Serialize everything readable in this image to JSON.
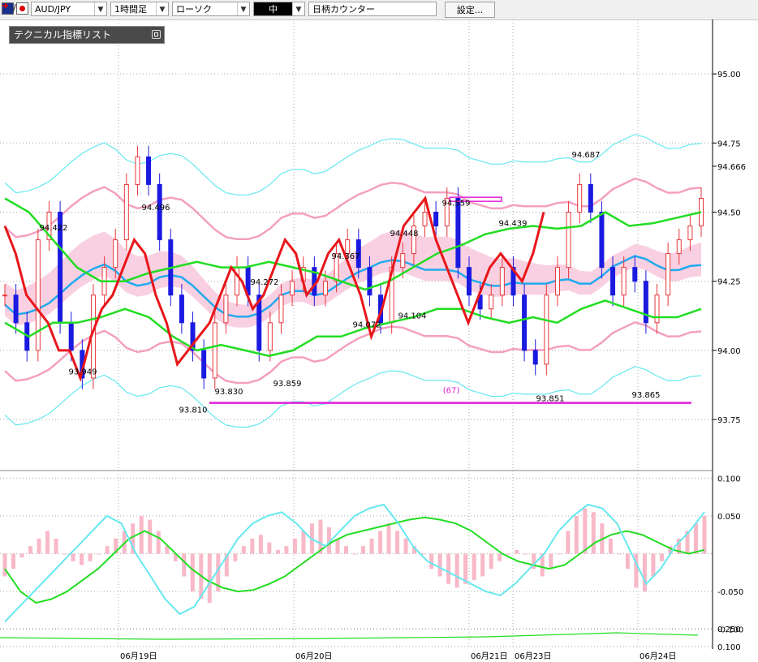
{
  "toolbar": {
    "symbol": "AUD/JPY",
    "symbol_sep": "/",
    "timeframe": "1時間足",
    "chart_type": "ローソク",
    "size": "中",
    "counter_label": "日柄カウンター",
    "settings_label": "設定...",
    "icons": {
      "australia_flag": "australia-flag-icon",
      "japan_flag": "japan-flag-icon",
      "dropdown": "chevron-down-icon"
    }
  },
  "indicator_panel": {
    "title": "テクニカル指標リスト",
    "button_icon": "restore-icon"
  },
  "colors": {
    "bull": "#e8373c",
    "bear": "#1a1ae0",
    "red_line": "#e8161a",
    "green": "#22dd22",
    "bb_outer": "#66e8f0",
    "bb_inner": "#f4a0c0",
    "ma": "#22aaee",
    "cloud": "#f8c8dc",
    "cloud_blue": "#c8e0f8",
    "magenta": "#e020d8",
    "macd_hist": "#f8b8c8",
    "grid": "#aaaaaa"
  },
  "chart_data": [
    {
      "type": "candlestick",
      "symbol": "AUD/JPY",
      "timeframe": "1時間足",
      "ylim": [
        93.58,
        95.15
      ],
      "y_ticks": [
        "95.00",
        "94.75",
        "94.666",
        "94.50",
        "94.25",
        "94.00",
        "93.75"
      ],
      "x_labels": [
        "06月19日",
        "06月20日",
        "06月21日",
        "06月23日",
        "06月24日"
      ],
      "annotations": [
        {
          "text": "94.422",
          "price": 94.422
        },
        {
          "text": "93.949",
          "price": 93.949
        },
        {
          "text": "94.496",
          "price": 94.496
        },
        {
          "text": "93.810",
          "price": 93.81
        },
        {
          "text": "93.830",
          "price": 93.83
        },
        {
          "text": "94.272",
          "price": 94.272
        },
        {
          "text": "93.859",
          "price": 93.859
        },
        {
          "text": "94.367",
          "price": 94.367
        },
        {
          "text": "94.072",
          "price": 94.072
        },
        {
          "text": "94.448",
          "price": 94.448
        },
        {
          "text": "94.104",
          "price": 94.104
        },
        {
          "text": "94.559",
          "price": 94.559
        },
        {
          "text": "94.439",
          "price": 94.439
        },
        {
          "text": "93.851",
          "price": 93.851
        },
        {
          "text": "94.687",
          "price": 94.687
        },
        {
          "text": "93.865",
          "price": 93.865
        },
        {
          "text": "(67)",
          "price": 93.86
        }
      ],
      "levels": [
        {
          "name": "low-line",
          "price": 93.81
        },
        {
          "name": "high-box",
          "price": 94.545
        }
      ],
      "series": [
        {
          "name": "close",
          "values": [
            94.2,
            94.1,
            94.0,
            94.4,
            94.5,
            94.1,
            94.0,
            93.9,
            94.2,
            94.3,
            94.4,
            94.6,
            94.7,
            94.6,
            94.4,
            94.2,
            94.1,
            94.0,
            93.9,
            94.1,
            94.2,
            94.3,
            94.2,
            94.0,
            94.1,
            94.2,
            94.25,
            94.3,
            94.2,
            94.25,
            94.35,
            94.4,
            94.3,
            94.2,
            94.1,
            94.3,
            94.35,
            94.45,
            94.5,
            94.45,
            94.55,
            94.3,
            94.2,
            94.15,
            94.2,
            94.3,
            94.2,
            94.0,
            93.95,
            94.2,
            94.3,
            94.5,
            94.6,
            94.5,
            94.3,
            94.2,
            94.3,
            94.25,
            94.1,
            94.2,
            94.35,
            94.4,
            94.45,
            94.55
          ]
        },
        {
          "name": "red-line",
          "values": [
            94.45,
            94.35,
            94.2,
            94.15,
            94.1,
            94.0,
            94.0,
            93.9,
            94.05,
            94.15,
            94.2,
            94.3,
            94.4,
            94.35,
            94.2,
            94.1,
            93.95,
            94.0,
            94.05,
            94.1,
            94.2,
            94.3,
            94.25,
            94.15,
            94.2,
            94.3,
            94.4,
            94.35,
            94.2,
            94.25,
            94.35,
            94.4,
            94.3,
            94.2,
            94.05,
            94.15,
            94.3,
            94.45,
            94.5,
            94.55,
            94.4,
            94.3,
            94.2,
            94.1,
            94.2,
            94.3,
            94.35,
            94.3,
            94.25,
            94.35,
            94.5
          ]
        },
        {
          "name": "green-upper",
          "values": [
            94.55,
            94.5,
            94.4,
            94.3,
            94.25,
            94.25,
            94.28,
            94.3,
            94.32,
            94.3,
            94.3,
            94.32,
            94.3,
            94.28,
            94.25,
            94.22,
            94.25,
            94.3,
            94.35,
            94.38,
            94.42,
            94.44,
            94.45,
            94.44,
            94.45,
            94.5,
            94.45,
            94.46,
            94.48,
            94.5
          ]
        },
        {
          "name": "green-lower",
          "values": [
            94.1,
            94.05,
            94.1,
            94.1,
            94.12,
            94.15,
            94.12,
            94.05,
            94.0,
            94.02,
            94.0,
            93.98,
            94.0,
            94.05,
            94.05,
            94.08,
            94.1,
            94.12,
            94.15,
            94.15,
            94.12,
            94.1,
            94.12,
            94.1,
            94.15,
            94.18,
            94.15,
            94.12,
            94.12,
            94.15
          ]
        }
      ]
    },
    {
      "type": "bar",
      "name": "macd",
      "ylim": [
        -0.11,
        0.11
      ],
      "y_ticks": [
        "0.100",
        "0.050",
        "-0.050",
        "-0.100"
      ],
      "series": [
        {
          "name": "histogram",
          "values": [
            -0.03,
            -0.02,
            -0.005,
            0.01,
            0.02,
            0.03,
            0.02,
            0.0,
            -0.01,
            -0.015,
            -0.01,
            0.0,
            0.01,
            0.02,
            0.03,
            0.04,
            0.05,
            0.045,
            0.03,
            0.01,
            -0.01,
            -0.03,
            -0.05,
            -0.06,
            -0.065,
            -0.05,
            -0.03,
            -0.01,
            0.01,
            0.02,
            0.025,
            0.015,
            0.005,
            0.01,
            0.02,
            0.03,
            0.04,
            0.045,
            0.035,
            0.02,
            0.01,
            0.0,
            0.01,
            0.02,
            0.03,
            0.04,
            0.03,
            0.02,
            0.01,
            0.0,
            -0.02,
            -0.03,
            -0.04,
            -0.045,
            -0.04,
            -0.035,
            -0.03,
            -0.02,
            -0.01,
            0.0,
            0.005,
            0.0,
            -0.02,
            -0.03,
            -0.02,
            0.0,
            0.03,
            0.05,
            0.06,
            0.055,
            0.04,
            0.02,
            0.0,
            -0.02,
            -0.045,
            -0.05,
            -0.03,
            -0.01,
            0.01,
            0.02,
            0.03,
            0.04,
            0.05
          ]
        },
        {
          "name": "cyan",
          "values": [
            -0.09,
            -0.07,
            -0.05,
            -0.03,
            -0.01,
            0.01,
            0.03,
            0.05,
            0.04,
            0.0,
            -0.03,
            -0.06,
            -0.08,
            -0.07,
            -0.04,
            -0.01,
            0.02,
            0.04,
            0.05,
            0.055,
            0.04,
            0.02,
            0.01,
            0.03,
            0.05,
            0.06,
            0.065,
            0.04,
            0.01,
            -0.01,
            -0.02,
            -0.03,
            -0.04,
            -0.05,
            -0.055,
            -0.04,
            -0.02,
            0.0,
            0.03,
            0.05,
            0.065,
            0.06,
            0.04,
            0.0,
            -0.04,
            -0.02,
            0.01,
            0.03,
            0.055
          ]
        },
        {
          "name": "green",
          "values": [
            -0.02,
            -0.05,
            -0.065,
            -0.06,
            -0.05,
            -0.035,
            -0.02,
            0.0,
            0.02,
            0.03,
            0.02,
            0.0,
            -0.02,
            -0.035,
            -0.045,
            -0.05,
            -0.048,
            -0.04,
            -0.03,
            -0.015,
            0.0,
            0.015,
            0.025,
            0.03,
            0.035,
            0.04,
            0.045,
            0.048,
            0.045,
            0.04,
            0.03,
            0.015,
            0.0,
            -0.01,
            -0.015,
            -0.02,
            -0.015,
            0.0,
            0.015,
            0.025,
            0.03,
            0.025,
            0.015,
            0.005,
            0.0,
            0.005
          ]
        }
      ]
    },
    {
      "type": "line",
      "name": "sub-indicator",
      "y_ticks": [
        "0.250",
        "0.100"
      ]
    }
  ]
}
